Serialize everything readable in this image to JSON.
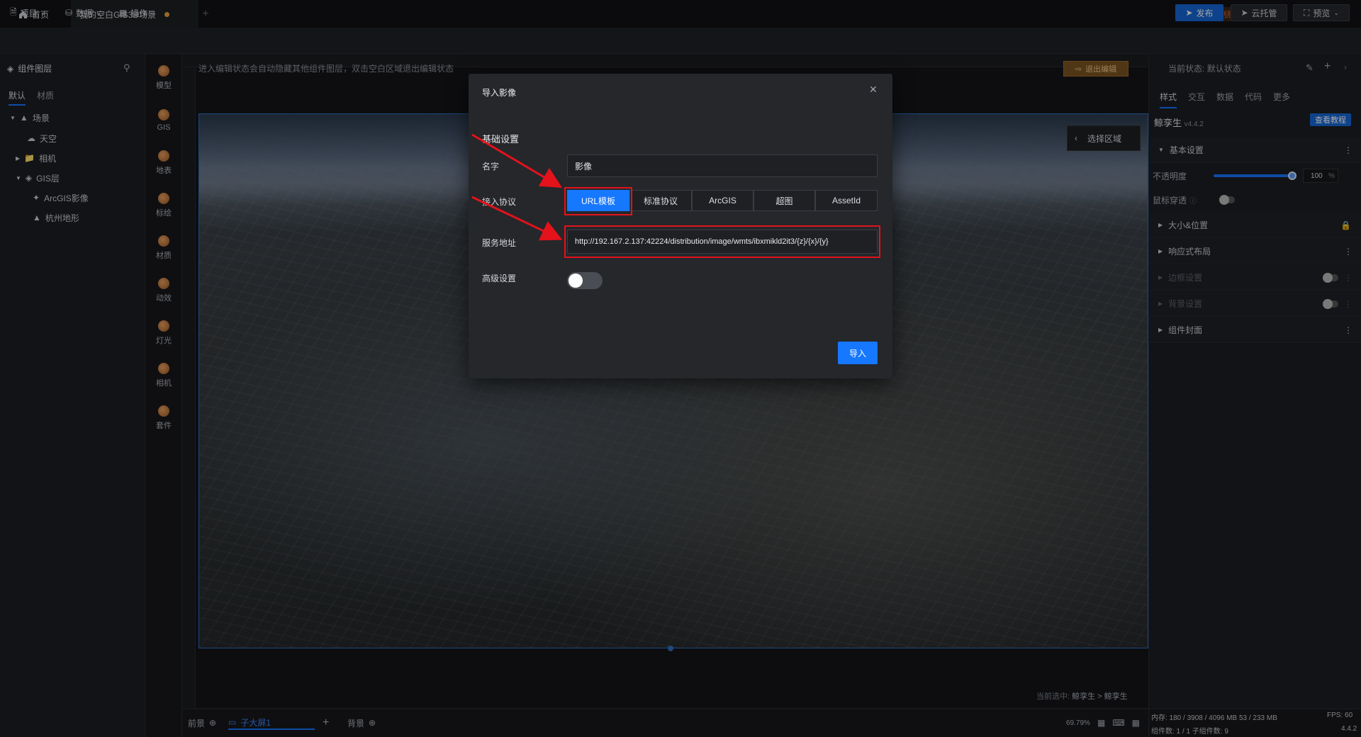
{
  "titlebar": {
    "home_tab": "首页",
    "doc_tab": "我的空白GIS3D场景",
    "custom_service": "定制服务"
  },
  "menubar": {
    "project": "项目",
    "data": "数据",
    "operate": "操作",
    "publish": "发布",
    "cloud": "云托管",
    "preview": "预览"
  },
  "leftpanel": {
    "title": "组件图层",
    "tabs": [
      "默认",
      "材质"
    ],
    "tree": [
      {
        "label": "场景"
      },
      {
        "label": "天空"
      },
      {
        "label": "相机"
      },
      {
        "label": "GIS层"
      },
      {
        "label": "ArcGIS影像"
      },
      {
        "label": "杭州地形"
      }
    ]
  },
  "rail": {
    "items": [
      {
        "label": "模型"
      },
      {
        "label": "GIS"
      },
      {
        "label": "地表"
      },
      {
        "label": "标绘"
      },
      {
        "label": "材质"
      },
      {
        "label": "动效"
      },
      {
        "label": "灯光"
      },
      {
        "label": "相机"
      },
      {
        "label": "套件"
      }
    ]
  },
  "canvas": {
    "hint": "进入编辑状态会自动隐藏其他组件图层，双击空白区域退出编辑状态",
    "exit_edit": "退出编辑",
    "select_region": "选择区域",
    "current_selection_prefix": "当前选中:",
    "current_selection_path": "鲸孪生 > 鲸孪生"
  },
  "bottombar": {
    "foreground": "前景",
    "sub_screen": "子大屏1",
    "background": "背景",
    "zoom": "69.79%"
  },
  "rightpanel": {
    "state_label": "当前状态:",
    "state_value": "默认状态",
    "tabs": [
      "样式",
      "交互",
      "数据",
      "代码",
      "更多"
    ],
    "component_name": "鲸孪生",
    "version": "v4.4.2",
    "tutorial": "查看教程",
    "sections": {
      "basic": "基本设置",
      "opacity_label": "不透明度",
      "opacity_value": "100",
      "opacity_unit": "%",
      "mouse_through": "鼠标穿透",
      "size_pos": "大小&位置",
      "responsive": "响应式布局",
      "border": "边框设置",
      "bg": "背景设置",
      "cover": "组件封面"
    },
    "stats": {
      "memory": "内存: 180 / 3908 / 4096 MB  53 / 233 MB",
      "fps": "FPS: 60",
      "count": "组件数: 1 / 1  子组件数: 9",
      "ver": "4.4.2"
    }
  },
  "dialog": {
    "title": "导入影像",
    "section": "基础设置",
    "name_label": "名字",
    "name_value": "影像",
    "protocol_label": "接入协议",
    "protocols": [
      "URL模板",
      "标准协议",
      "ArcGIS",
      "超图",
      "AssetId"
    ],
    "active_protocol_index": 0,
    "url_label": "服务地址",
    "url_value": "http://192.167.2.137:42224/distribution/image/wmts/ibxmikld2it3/{z}/{x}/{y}",
    "advanced_label": "高级设置",
    "advanced_enabled": false,
    "import_button": "导入"
  },
  "colors": {
    "accent": "#1677ff",
    "annotation_red": "#e3121b",
    "exit_edit": "#7a5420"
  }
}
